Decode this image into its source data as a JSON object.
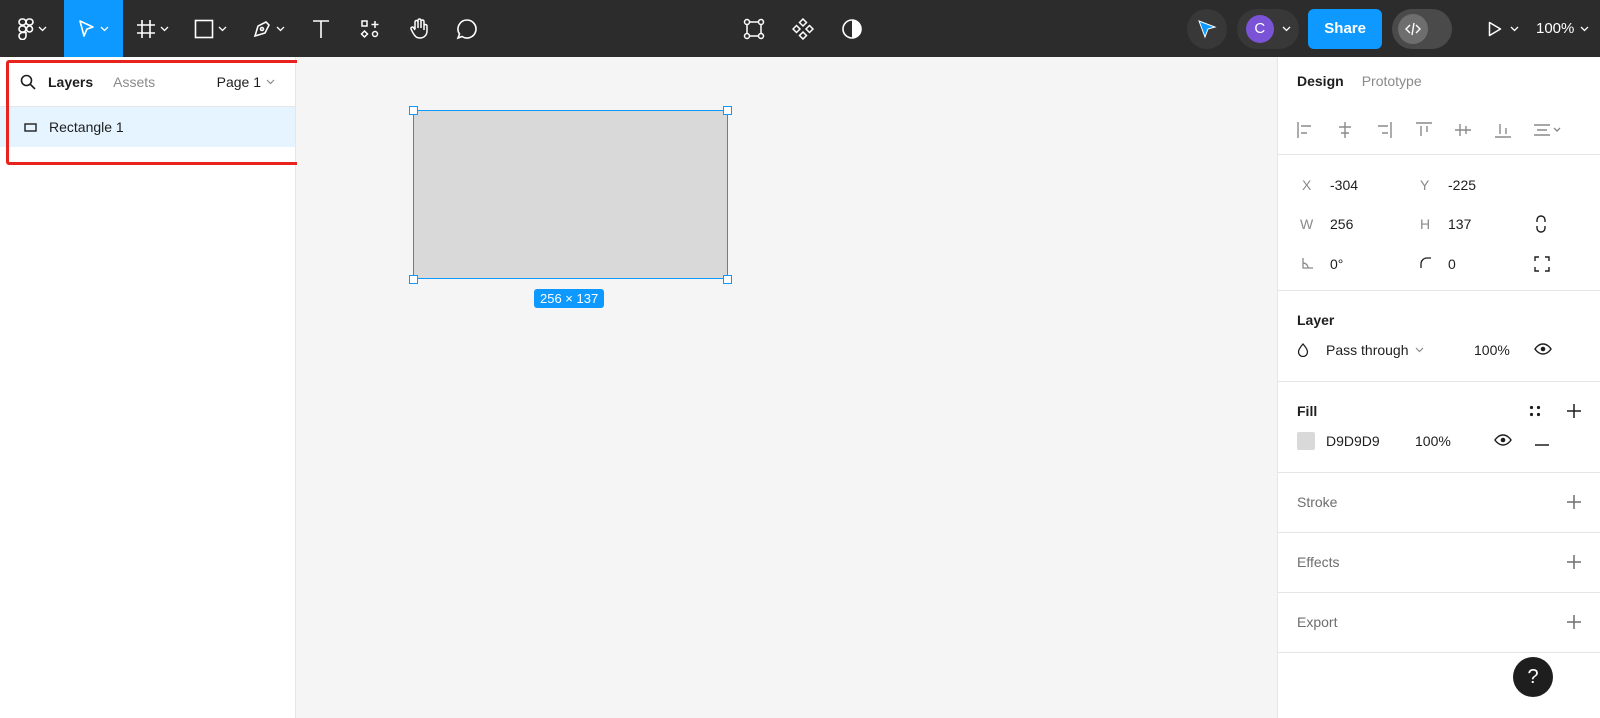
{
  "toolbar": {
    "tools": [
      "figma-menu-icon",
      "move-tool-icon",
      "frame-tool-icon",
      "rectangle-tool-icon",
      "pen-tool-icon",
      "text-tool-icon",
      "resources-icon",
      "hand-tool-icon",
      "comment-icon"
    ],
    "center_tools": [
      "edit-object-icon",
      "component-icon",
      "mask-icon"
    ],
    "avatar_initial": "C",
    "share_label": "Share",
    "zoom_label": "100%"
  },
  "left_panel": {
    "tabs": [
      {
        "label": "Layers",
        "active": true
      },
      {
        "label": "Assets",
        "active": false
      }
    ],
    "page_label": "Page 1",
    "layers": [
      {
        "name": "Rectangle 1",
        "type": "rectangle",
        "selected": true
      }
    ]
  },
  "canvas": {
    "selection_size_label": "256 × 137",
    "rect_fill": "#D9D9D9",
    "selection_color": "#0D99FF"
  },
  "right_panel": {
    "tabs": [
      {
        "label": "Design",
        "active": true
      },
      {
        "label": "Prototype",
        "active": false
      }
    ],
    "position": {
      "x_label": "X",
      "x_value": "-304",
      "y_label": "Y",
      "y_value": "-225",
      "w_label": "W",
      "w_value": "256",
      "h_label": "H",
      "h_value": "137",
      "rotation_value": "0°",
      "radius_value": "0"
    },
    "layer": {
      "title": "Layer",
      "blend_mode": "Pass through",
      "opacity": "100%"
    },
    "fill": {
      "title": "Fill",
      "hex": "D9D9D9",
      "opacity": "100%"
    },
    "stroke_title": "Stroke",
    "effects_title": "Effects",
    "export_title": "Export"
  },
  "help_label": "?"
}
